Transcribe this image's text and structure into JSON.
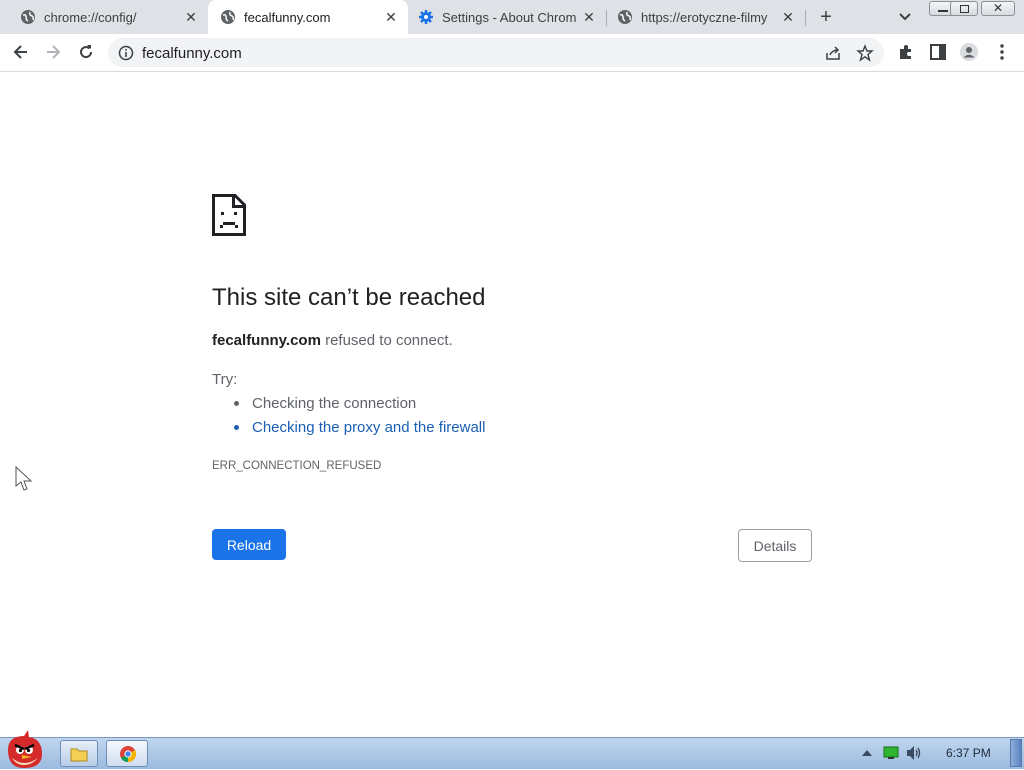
{
  "tabs": [
    {
      "title": "chrome://config/",
      "icon": "globe-icon",
      "active": false
    },
    {
      "title": "fecalfunny.com",
      "icon": "globe-icon",
      "active": true
    },
    {
      "title": "Settings - About Chrom",
      "icon": "settings-gear-icon",
      "active": false
    },
    {
      "title": "https://erotyczne-filmy",
      "icon": "globe-icon",
      "active": false
    }
  ],
  "toolbar": {
    "url": "fecalfunny.com"
  },
  "error": {
    "heading": "This site can’t be reached",
    "domain": "fecalfunny.com",
    "message": " refused to connect.",
    "try_label": "Try:",
    "suggestions": [
      {
        "text": "Checking the connection",
        "is_link": false
      },
      {
        "text": "Checking the proxy and the firewall",
        "is_link": true
      }
    ],
    "code": "ERR_CONNECTION_REFUSED",
    "reload_label": "Reload",
    "details_label": "Details"
  },
  "taskbar": {
    "time": "6:37 PM"
  },
  "colors": {
    "accent": "#1a73e8",
    "link": "#1a5fb4",
    "tabstrip_bg": "#dee1e6"
  }
}
